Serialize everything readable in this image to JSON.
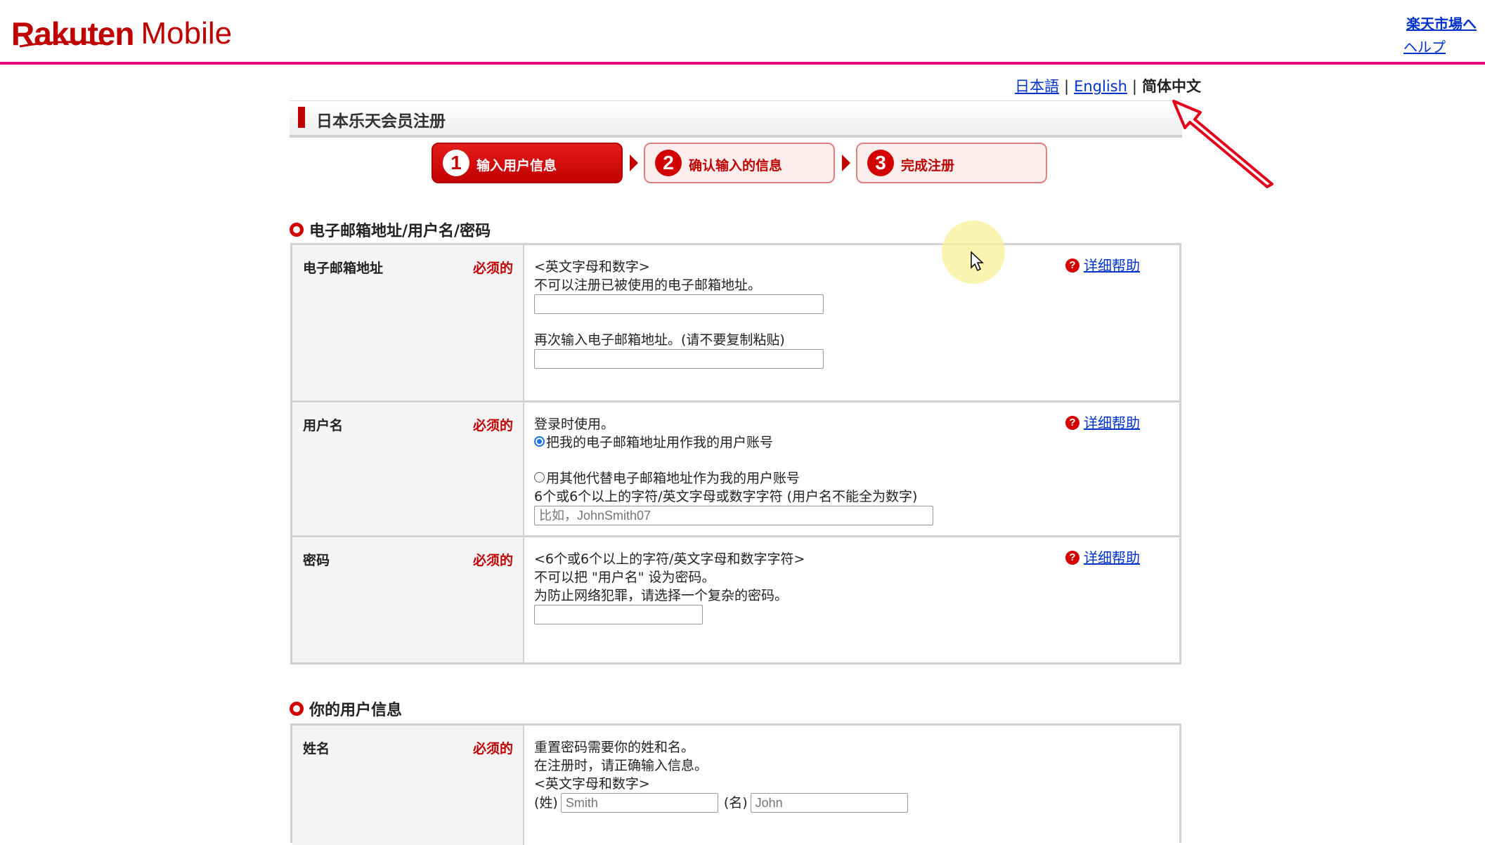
{
  "header": {
    "logo_text_1": "Rakuten",
    "logo_text_2": "Mobile",
    "market_link": "楽天市場へ",
    "help_link": "ヘルプ"
  },
  "language": {
    "japanese": "日本語",
    "english": "English",
    "chinese": "简体中文",
    "separator": "|"
  },
  "page": {
    "title": "日本乐天会员注册"
  },
  "steps": [
    {
      "num": "1",
      "label": "输入用户信息",
      "active": true
    },
    {
      "num": "2",
      "label": "确认输入的信息",
      "active": false
    },
    {
      "num": "3",
      "label": "完成注册",
      "active": false
    }
  ],
  "section1": {
    "heading": "电子邮箱地址/用户名/密码",
    "required_label": "必须的",
    "help_label": "详细帮助",
    "email": {
      "label": "电子邮箱地址",
      "hint1": "<英文字母和数字>",
      "hint2": "不可以注册已被使用的电子邮箱地址。",
      "confirm_hint": "再次输入电子邮箱地址。(请不要复制粘贴)"
    },
    "username": {
      "label": "用户名",
      "hint": "登录时使用。",
      "option1": "把我的电子邮箱地址用作我的用户账号",
      "option2": "用其他代替电子邮箱地址作为我的用户账号",
      "rule": "6个或6个以上的字符/英文字母或数字字符 (用户名不能全为数字)",
      "placeholder": "比如，JohnSmith07"
    },
    "password": {
      "label": "密码",
      "hint1": "<6个或6个以上的字符/英文字母和数字字符>",
      "hint2": "不可以把 \"用户名\" 设为密码。",
      "hint3": "为防止网络犯罪，请选择一个复杂的密码。"
    }
  },
  "section2": {
    "heading": "你的用户信息",
    "name": {
      "label": "姓名",
      "required": "必须的",
      "hint1": "重置密码需要你的姓和名。",
      "hint2": "在注册时，请正确输入信息。",
      "hint3": "<英文字母和数字>",
      "last_label": "(姓)",
      "last_placeholder": "Smith",
      "first_label": "(名)",
      "first_placeholder": "John"
    }
  },
  "colors": {
    "brand": "#bf0000",
    "header_line": "#e6007e",
    "link": "#0033cc"
  }
}
